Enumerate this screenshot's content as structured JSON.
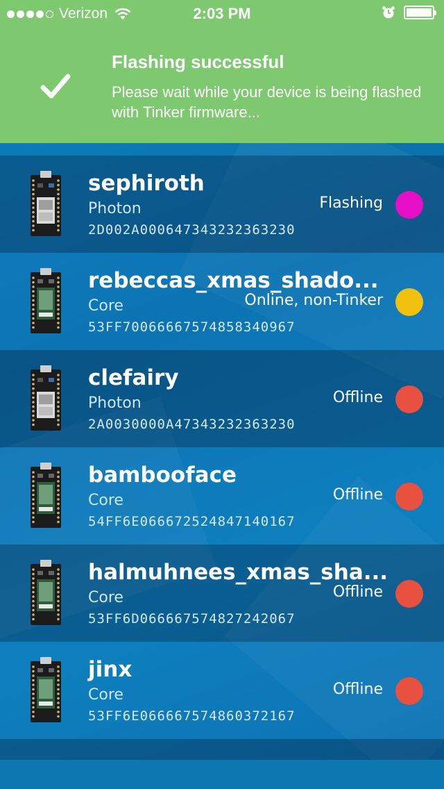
{
  "status_bar": {
    "carrier": "Verizon",
    "time": "2:03 PM"
  },
  "banner": {
    "title": "Flashing successful",
    "message": "Please wait while your device is being flashed with Tinker firmware...",
    "color": "#7ec86f"
  },
  "devices": [
    {
      "name": "sephiroth",
      "type": "Photon",
      "id": "2D002A000647343232363230",
      "status": "Flashing",
      "status_color": "#e60ec7",
      "board": "photon"
    },
    {
      "name": "rebeccas_xmas_shado...",
      "type": "Core",
      "id": "53FF70066667574858340967",
      "status": "Online, non-Tinker",
      "status_color": "#f2c10f",
      "board": "core"
    },
    {
      "name": "clefairy",
      "type": "Photon",
      "id": "2A0030000A47343232363230",
      "status": "Offline",
      "status_color": "#e8503f",
      "board": "photon"
    },
    {
      "name": "bambooface",
      "type": "Core",
      "id": "54FF6E066672524847140167",
      "status": "Offline",
      "status_color": "#e8503f",
      "board": "core"
    },
    {
      "name": "halmuhnees_xmas_sha...",
      "type": "Core",
      "id": "53FF6D066667574827242067",
      "status": "Offline",
      "status_color": "#e8503f",
      "board": "core"
    },
    {
      "name": "jinx",
      "type": "Core",
      "id": "53FF6E066667574860372167",
      "status": "Offline",
      "status_color": "#e8503f",
      "board": "core"
    }
  ]
}
